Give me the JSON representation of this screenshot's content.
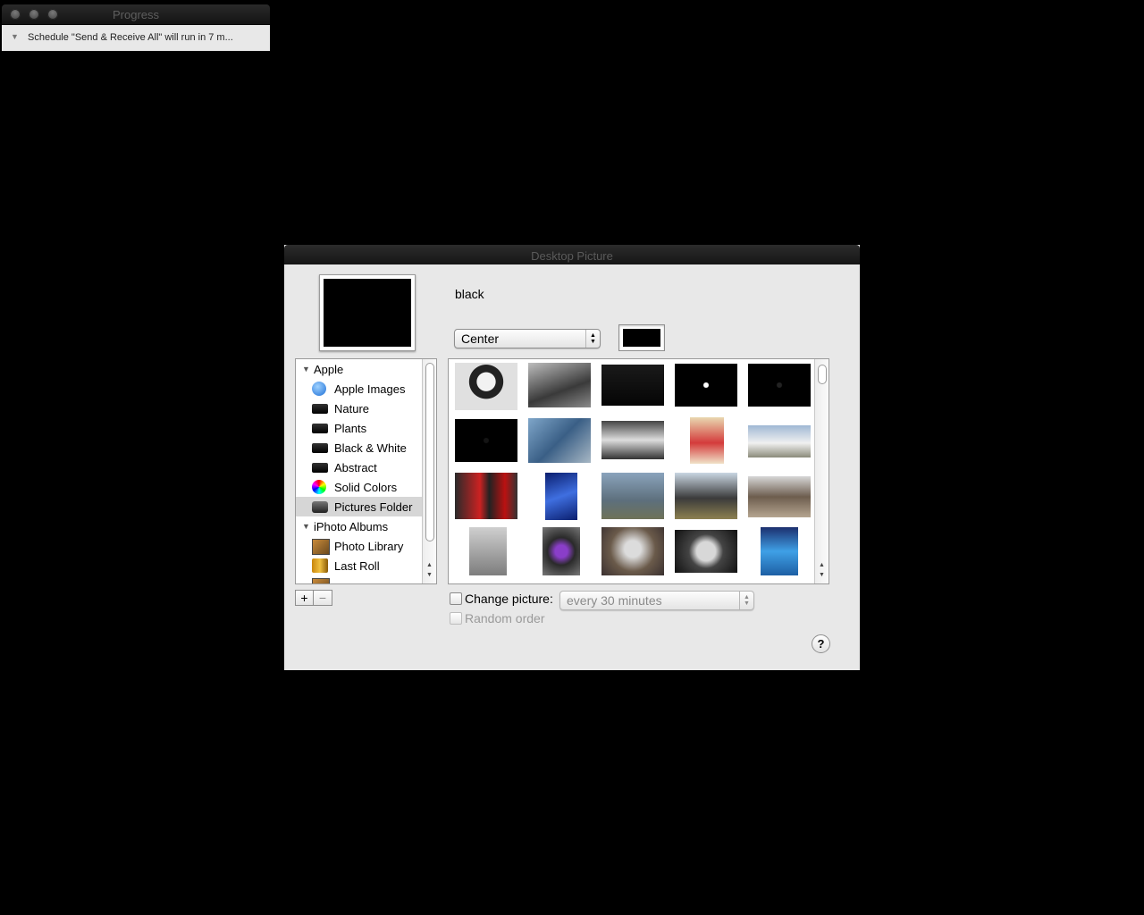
{
  "progress_window": {
    "title": "Progress",
    "message": "Schedule \"Send & Receive All\" will run in 7 m..."
  },
  "desktop_picture": {
    "title": "Desktop Picture",
    "picture_name": "black",
    "position_popup": {
      "selected": "Center"
    },
    "color_well_color": "#000000",
    "source_list": {
      "groups": [
        {
          "label": "Apple",
          "items": [
            {
              "label": "Apple Images",
              "icon": "apple-images-icon"
            },
            {
              "label": "Nature",
              "icon": "folder-icon"
            },
            {
              "label": "Plants",
              "icon": "folder-icon"
            },
            {
              "label": "Black & White",
              "icon": "folder-icon"
            },
            {
              "label": "Abstract",
              "icon": "folder-icon"
            },
            {
              "label": "Solid Colors",
              "icon": "color-wheel-icon"
            },
            {
              "label": "Pictures Folder",
              "icon": "pictures-folder-icon",
              "selected": true
            }
          ]
        },
        {
          "label": "iPhoto Albums",
          "items": [
            {
              "label": "Photo Library",
              "icon": "photo-library-icon"
            },
            {
              "label": "Last Roll",
              "icon": "last-roll-icon"
            }
          ]
        }
      ]
    },
    "add_button_label": "+",
    "remove_button_label": "−",
    "change_picture": {
      "label": "Change picture:",
      "checked": false,
      "interval": "every 30 minutes"
    },
    "random_order": {
      "label": "Random order",
      "checked": false,
      "enabled": false
    },
    "help_label": "?"
  }
}
